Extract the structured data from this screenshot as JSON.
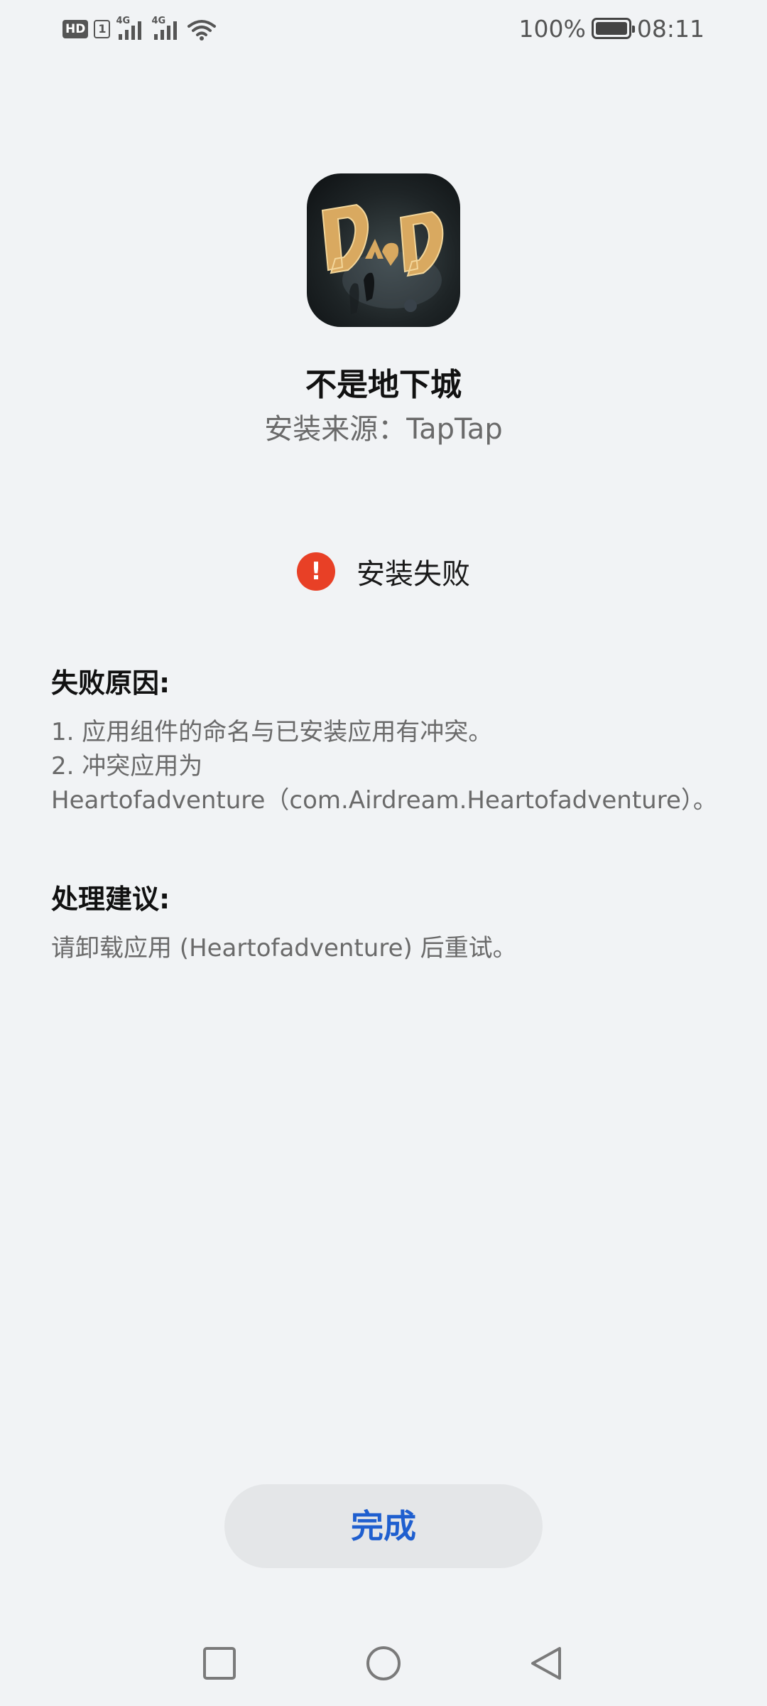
{
  "status_bar": {
    "hd_label": "HD",
    "sim_label": "1",
    "network_type_1": "4G",
    "network_type_2": "4G",
    "battery_percent": "100%",
    "time": "08:11",
    "icons": [
      "hd-icon",
      "signal-icon",
      "signal-icon",
      "wifi-icon",
      "battery-icon"
    ]
  },
  "app": {
    "name": "不是地下城",
    "source": "安装来源：TapTap",
    "icon": "dnd-app-icon"
  },
  "result": {
    "status_text": "安装失败",
    "icon": "error-icon",
    "icon_glyph": "!",
    "icon_color": "#e84026"
  },
  "reason": {
    "title": "失败原因:",
    "lines": [
      "1. 应用组件的命名与已安装应用有冲突。",
      "2. 冲突应用为",
      "Heartofadventure（com.Airdream.Heartofadventure）。"
    ]
  },
  "advice": {
    "title": "处理建议:",
    "lines": [
      "请卸载应用 (Heartofadventure) 后重试。"
    ]
  },
  "actions": {
    "done_label": "完成",
    "done_color": "#1f5fcf"
  },
  "nav_bar": {
    "icons": [
      "recent-apps-icon",
      "home-icon",
      "back-icon"
    ]
  }
}
